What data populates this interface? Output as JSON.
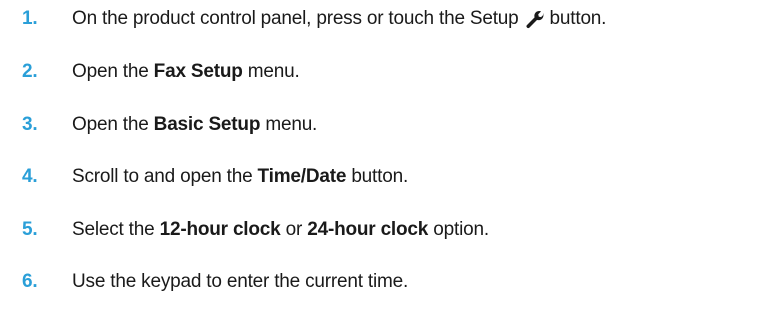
{
  "steps": [
    {
      "number": "1.",
      "text_before": "On the product control panel, press or touch the Setup",
      "icon": "wrench-icon",
      "text_after": "button."
    },
    {
      "number": "2.",
      "text_before": "Open the",
      "bold": "Fax Setup",
      "text_after": "menu."
    },
    {
      "number": "3.",
      "text_before": "Open the",
      "bold": "Basic Setup",
      "text_after": "menu."
    },
    {
      "number": "4.",
      "text_before": "Scroll to and open the",
      "bold": "Time/Date",
      "text_after": "button."
    },
    {
      "number": "5.",
      "text_before": "Select the",
      "bold": "12-hour clock",
      "text_middle": "or",
      "bold2": "24-hour clock",
      "text_after": "option."
    },
    {
      "number": "6.",
      "text_before": "Use the keypad to enter the current time."
    }
  ],
  "colors": {
    "step_number": "#2a9fd8",
    "text": "#1a1a1a"
  }
}
